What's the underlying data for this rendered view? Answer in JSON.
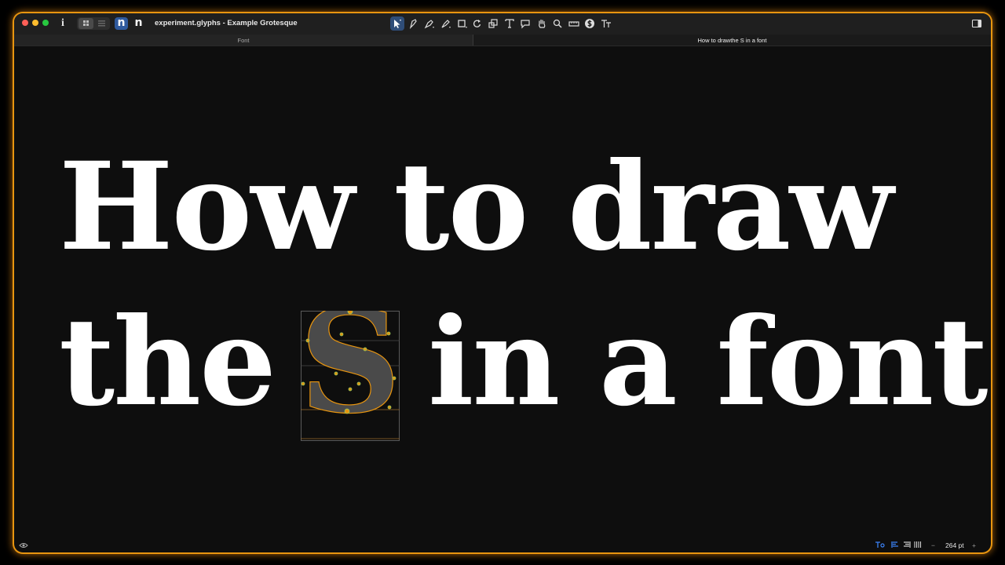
{
  "window": {
    "title": "experiment.glyphs - Example Grotesque",
    "traffic_lights": {
      "close": "#ff5f57",
      "minimize": "#febc2e",
      "zoom": "#28c840"
    },
    "accent": "#e8950f"
  },
  "toolbar": {
    "view_toggle_glyph_1": "n",
    "view_toggle_glyph_2": "n",
    "tools": [
      "select-tool-icon",
      "draw-tool-icon",
      "pen-tool-icon",
      "brush-tool-icon",
      "rectangle-tool-icon",
      "rotate-tool-icon",
      "scale-tool-icon",
      "text-tool-icon",
      "annotation-tool-icon",
      "hand-tool-icon",
      "zoom-tool-icon",
      "measure-tool-icon",
      "dollar-glyph-icon",
      "type-size-icon"
    ]
  },
  "tabs": [
    {
      "label": "Font",
      "active": false
    },
    {
      "label": "How to drawthe S in a font",
      "active": true
    }
  ],
  "canvas": {
    "line1": "How to draw",
    "line2_before": "the",
    "glyph": "S",
    "line2_after": "in a font"
  },
  "status": {
    "zoom": "264 pt",
    "minus": "−",
    "plus": "+"
  }
}
